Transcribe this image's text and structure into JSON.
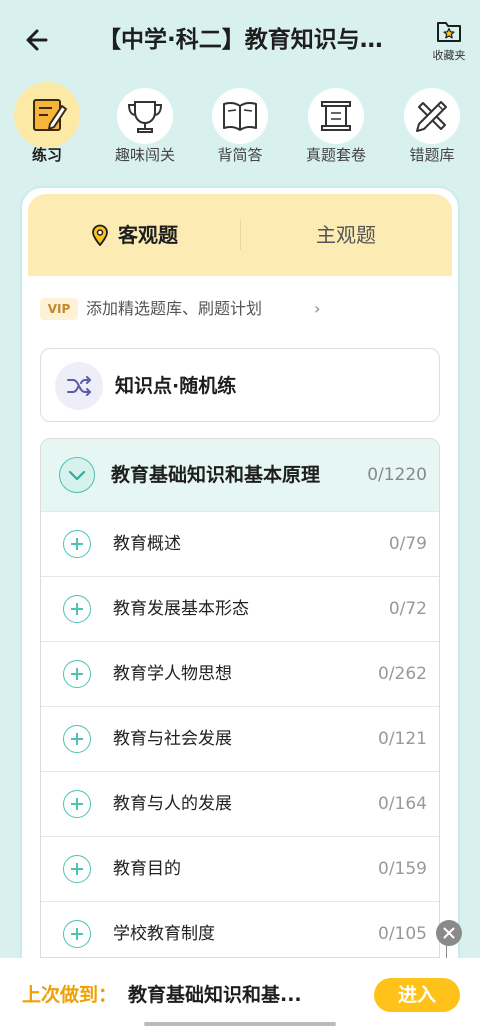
{
  "header": {
    "title": "【中学·科二】教育知识与…",
    "favorites_label": "收藏夹"
  },
  "categories": [
    {
      "label": "练习",
      "icon": "pencil-notebook-icon",
      "active": true
    },
    {
      "label": "趣味闯关",
      "icon": "trophy-icon",
      "active": false
    },
    {
      "label": "背简答",
      "icon": "open-book-icon",
      "active": false
    },
    {
      "label": "真题套卷",
      "icon": "scroll-icon",
      "active": false
    },
    {
      "label": "错题库",
      "icon": "pencil-ruler-icon",
      "active": false
    }
  ],
  "tabs": {
    "objective": "客观题",
    "subjective": "主观题"
  },
  "vip": {
    "badge": "VIP",
    "text": "添加精选题库、刷题计划",
    "chevron": "›"
  },
  "random_practice": {
    "label": "知识点·随机练"
  },
  "chapter": {
    "title": "教育基础知识和基本原理",
    "count": "0/1220",
    "items": [
      {
        "label": "教育概述",
        "count": "0/79"
      },
      {
        "label": "教育发展基本形态",
        "count": "0/72"
      },
      {
        "label": "教育学人物思想",
        "count": "0/262"
      },
      {
        "label": "教育与社会发展",
        "count": "0/121"
      },
      {
        "label": "教育与人的发展",
        "count": "0/164"
      },
      {
        "label": "教育目的",
        "count": "0/159"
      },
      {
        "label": "学校教育制度",
        "count": "0/105"
      }
    ]
  },
  "bottom": {
    "last_label": "上次做到：",
    "last_title": "教育基础知识和基...",
    "enter_label": "进入"
  },
  "colors": {
    "background": "#d9f1ee",
    "accent_teal": "#4cc3b3",
    "tab_yellow": "#fcecb3",
    "enter_button": "#ffc21a",
    "last_label": "#f0a000"
  }
}
